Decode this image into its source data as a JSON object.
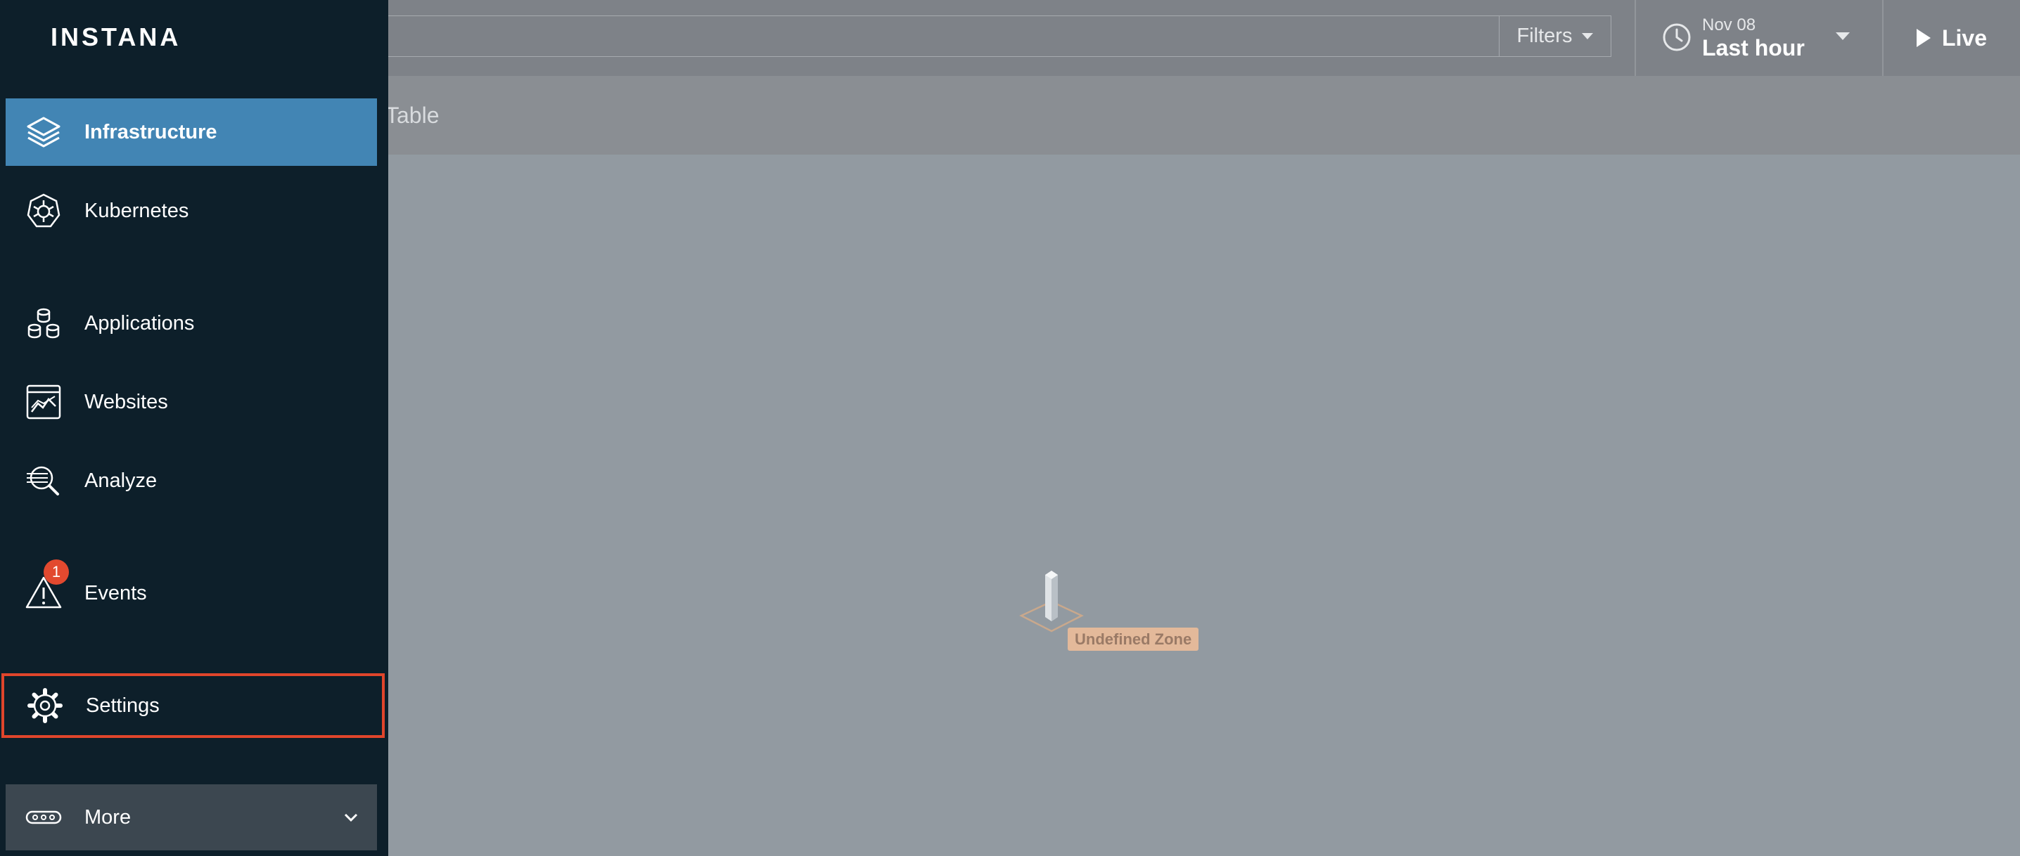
{
  "topbar": {
    "filters_label": "Filters",
    "time_date": "Nov 08",
    "time_range": "Last hour",
    "live_label": "Live"
  },
  "subbar": {
    "partial_tab_label": "Table"
  },
  "map": {
    "zone_label": "Undefined Zone"
  },
  "sidebar": {
    "logo": "INSTANA",
    "items": [
      {
        "label": "Infrastructure",
        "icon": "layers-icon",
        "active": true
      },
      {
        "label": "Kubernetes",
        "icon": "kubernetes-icon"
      },
      {
        "label": "Applications",
        "icon": "applications-icon"
      },
      {
        "label": "Websites",
        "icon": "websites-icon"
      },
      {
        "label": "Analyze",
        "icon": "analyze-icon"
      },
      {
        "label": "Events",
        "icon": "warning-icon",
        "badge": "1"
      },
      {
        "label": "Settings",
        "icon": "gear-icon",
        "highlighted": true
      },
      {
        "label": "More",
        "icon": "more-icon"
      }
    ]
  },
  "colors": {
    "sidebar_bg": "#0d1f2a",
    "active_item": "#4285b4",
    "highlight_border": "#e0452b",
    "badge": "#e2492f"
  }
}
